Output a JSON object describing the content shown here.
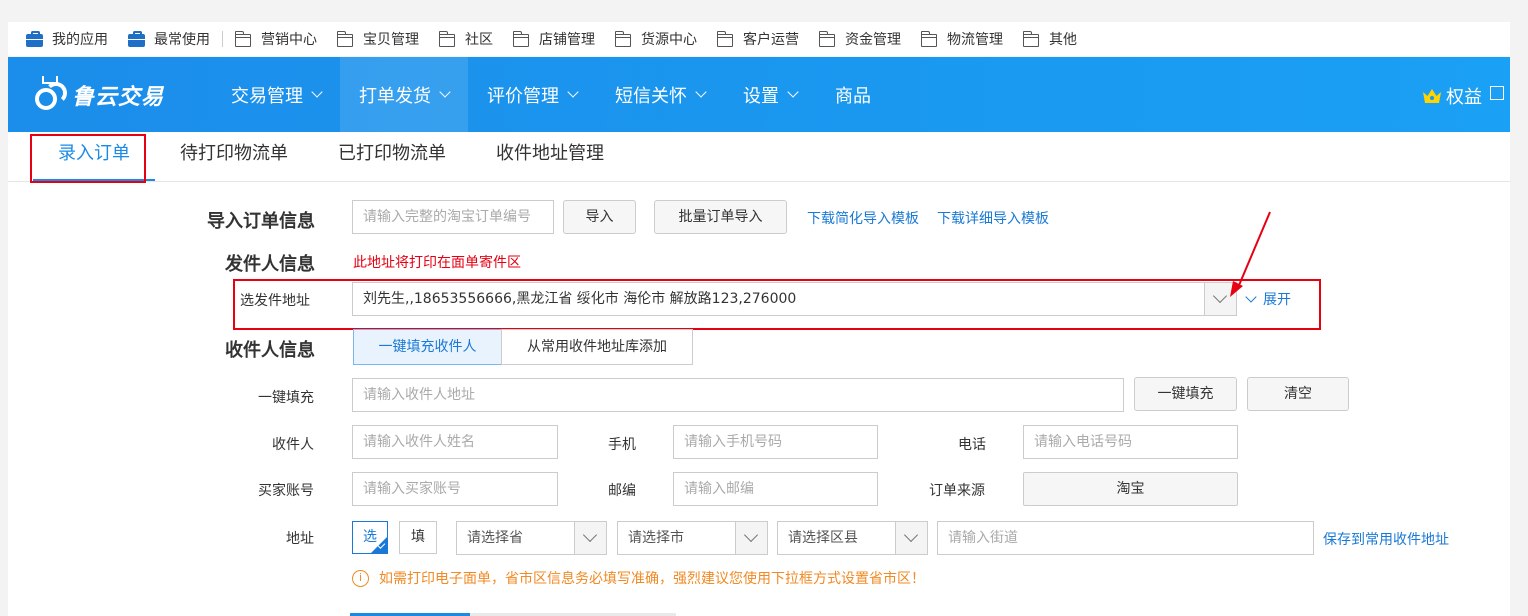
{
  "appbar": {
    "items": [
      {
        "label": "我的应用",
        "icon": "briefcase-icon"
      },
      {
        "label": "最常使用",
        "icon": "briefcase-icon"
      },
      {
        "label": "营销中心",
        "icon": "folder-icon"
      },
      {
        "label": "宝贝管理",
        "icon": "folder-icon"
      },
      {
        "label": "社区",
        "icon": "folder-icon"
      },
      {
        "label": "店铺管理",
        "icon": "folder-icon"
      },
      {
        "label": "货源中心",
        "icon": "folder-icon"
      },
      {
        "label": "客户运营",
        "icon": "folder-icon"
      },
      {
        "label": "资金管理",
        "icon": "folder-icon"
      },
      {
        "label": "物流管理",
        "icon": "folder-icon"
      },
      {
        "label": "其他",
        "icon": "folder-icon"
      }
    ]
  },
  "nav": {
    "logo_text": "鲁云交易",
    "items": [
      {
        "label": "交易管理",
        "dropdown": true
      },
      {
        "label": "打单发货",
        "dropdown": true,
        "active": true
      },
      {
        "label": "评价管理",
        "dropdown": true
      },
      {
        "label": "短信关怀",
        "dropdown": true
      },
      {
        "label": "设置",
        "dropdown": true
      },
      {
        "label": "商品",
        "dropdown": false
      }
    ],
    "rights_label": "权益"
  },
  "subtabs": [
    "录入订单",
    "待打印物流单",
    "已打印物流单",
    "收件地址管理"
  ],
  "import": {
    "label": "导入订单信息",
    "placeholder": "请输入完整的淘宝订单编号",
    "import_btn": "导入",
    "batch_btn": "批量订单导入",
    "link_simple": "下载简化导入模板",
    "link_detail": "下载详细导入模板"
  },
  "sender": {
    "label": "发件人信息",
    "note": "此地址将打印在面单寄件区",
    "select_label": "选发件地址",
    "selected_value": "刘先生,,18653556666,黑龙江省 绥化市  海伦市 解放路123,276000",
    "expand": "展开"
  },
  "receiver": {
    "label": "收件人信息",
    "tab_fill": "一键填充收件人",
    "tab_lib": "从常用收件地址库添加",
    "quickfill_label": "一键填充",
    "quickfill_placeholder": "请输入收件人地址",
    "quickfill_btn": "一键填充",
    "clear_btn": "清空",
    "name_label": "收件人",
    "name_placeholder": "请输入收件人姓名",
    "mobile_label": "手机",
    "mobile_placeholder": "请输入手机号码",
    "phone_label": "电话",
    "phone_placeholder": "请输入电话号码",
    "buyer_label": "买家账号",
    "buyer_placeholder": "请输入买家账号",
    "zip_label": "邮编",
    "zip_placeholder": "请输入邮编",
    "source_label": "订单来源",
    "source_value": "淘宝",
    "addr_label": "地址",
    "mode_select": "选",
    "mode_fill": "填",
    "province": "请选择省",
    "city": "请选择市",
    "district": "请选择区县",
    "street_placeholder": "请输入街道",
    "save_link": "保存到常用收件地址",
    "warning": "如需打印电子面单，省市区信息务必填写准确，强烈建议您使用下拉框方式设置省市区！",
    "warning_icon": "i"
  }
}
